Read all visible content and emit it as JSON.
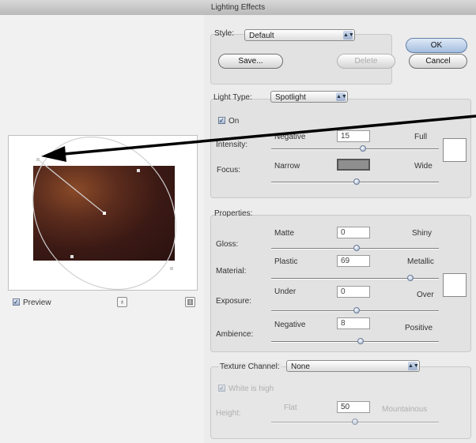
{
  "window": {
    "title": "Lighting Effects"
  },
  "style_group": {
    "label": "Style:",
    "selected": "Default",
    "save_button": "Save...",
    "delete_button": "Delete"
  },
  "dialog_buttons": {
    "ok": "OK",
    "cancel": "Cancel"
  },
  "light_type_group": {
    "label": "Light Type:",
    "selected": "Spotlight",
    "on_label": "On",
    "on_checked": true,
    "intensity": {
      "label": "Intensity:",
      "min_label": "Negative",
      "max_label": "Full",
      "value": "15"
    },
    "focus": {
      "label": "Focus:",
      "min_label": "Narrow",
      "max_label": "Wide",
      "value": ""
    }
  },
  "properties_group": {
    "label": "Properties:",
    "gloss": {
      "label": "Gloss:",
      "min_label": "Matte",
      "max_label": "Shiny",
      "value": "0"
    },
    "material": {
      "label": "Material:",
      "min_label": "Plastic",
      "max_label": "Metallic",
      "value": "69"
    },
    "exposure": {
      "label": "Exposure:",
      "min_label": "Under",
      "max_label": "Over",
      "value": "0"
    },
    "ambience": {
      "label": "Ambience:",
      "min_label": "Negative",
      "max_label": "Positive",
      "value": "8"
    }
  },
  "texture_group": {
    "label": "Texture Channel:",
    "selected": "None",
    "white_is_high_label": "White is high",
    "height": {
      "label": "Height:",
      "min_label": "Flat",
      "max_label": "Mountainous",
      "value": "50"
    }
  },
  "preview": {
    "label": "Preview",
    "checked": true
  },
  "icons": [
    "lightbulb-icon",
    "trash-icon",
    "checkmark-icon",
    "dropdown-arrow-icon",
    "annotation-arrow"
  ]
}
